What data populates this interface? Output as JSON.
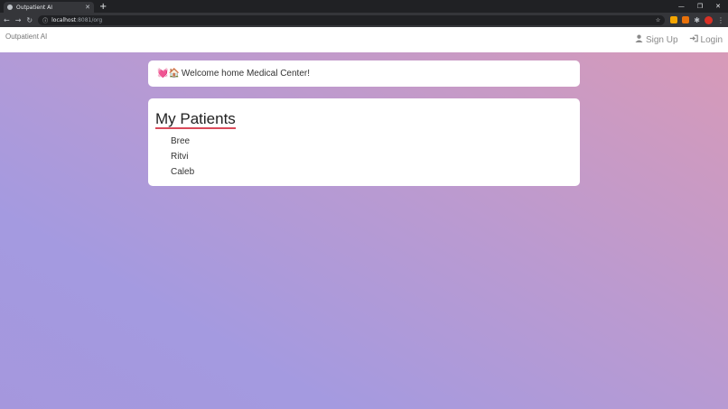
{
  "browser": {
    "tab_title": "Outpatient AI",
    "url_host": "localhost",
    "url_path": ":8081/org"
  },
  "nav": {
    "brand": "Outpatient AI",
    "signup": "Sign Up",
    "login": "Login"
  },
  "welcome": {
    "emojis": "💓🏠",
    "text": "Welcome home Medical Center!"
  },
  "patients": {
    "title": "My Patients",
    "items": [
      "Bree",
      "Ritvi",
      "Caleb"
    ]
  }
}
